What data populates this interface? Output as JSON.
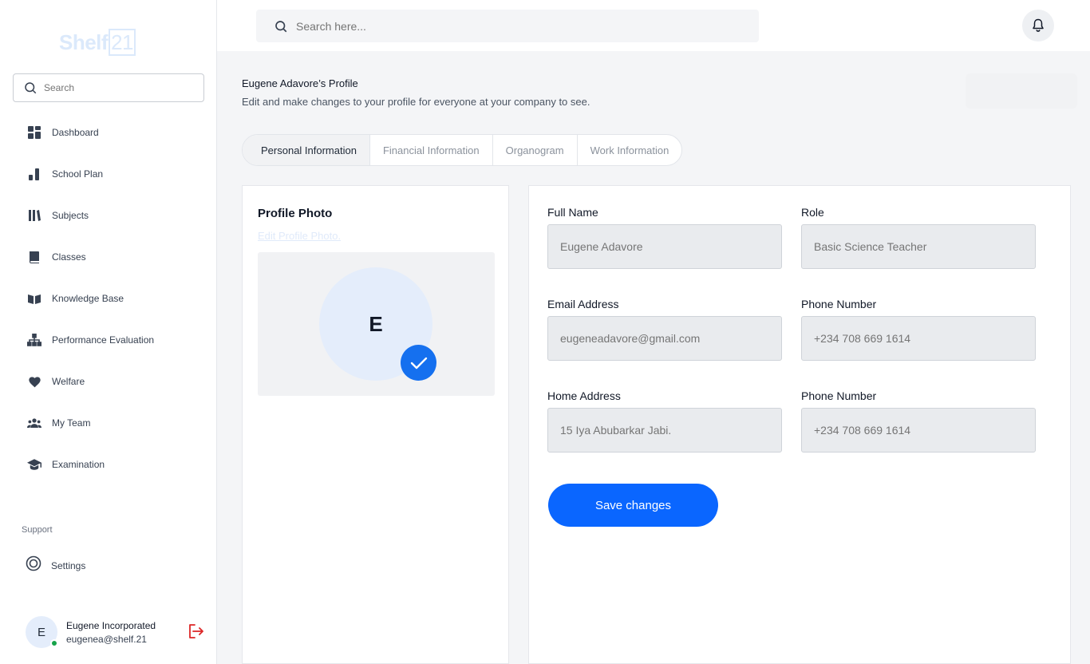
{
  "brand": {
    "logo_text": "Shelf",
    "logo_num": "21"
  },
  "sidebar": {
    "search_placeholder": "Search",
    "items": [
      {
        "label": "Dashboard",
        "icon": "dashboard-icon"
      },
      {
        "label": "School Plan",
        "icon": "bar-chart-icon"
      },
      {
        "label": "Subjects",
        "icon": "books-icon"
      },
      {
        "label": "Classes",
        "icon": "book-icon"
      },
      {
        "label": "Knowledge Base",
        "icon": "open-book-icon"
      },
      {
        "label": "Performance Evaluation",
        "icon": "hierarchy-icon"
      },
      {
        "label": "Welfare",
        "icon": "heart-icon"
      },
      {
        "label": "My Team",
        "icon": "team-icon"
      },
      {
        "label": "Examination",
        "icon": "graduation-cap-icon"
      }
    ],
    "support_label": "Support",
    "settings_label": "Settings"
  },
  "user": {
    "initial": "E",
    "name": "Eugene Incorporated",
    "email": "eugenea@shelf.21",
    "status_color": "#16a34a"
  },
  "topbar": {
    "search_placeholder": "Search here..."
  },
  "page": {
    "title": "Eugene Adavore’s Profile",
    "subtitle": "Edit and make changes to your profile for everyone at your company to see."
  },
  "tabs": [
    {
      "label": "Personal Information",
      "active": true
    },
    {
      "label": "Financial Information",
      "active": false
    },
    {
      "label": "Organogram",
      "active": false
    },
    {
      "label": "Work Information",
      "active": false
    }
  ],
  "photo": {
    "heading": "Profile Photo",
    "edit_link": "Edit Profile Photo.",
    "initial": "E"
  },
  "form": {
    "full_name": {
      "label": "Full Name",
      "placeholder": "Eugene Adavore"
    },
    "role": {
      "label": "Role",
      "placeholder": "Basic Science Teacher"
    },
    "email": {
      "label": "Email Address",
      "placeholder": "eugeneadavore@gmail.com"
    },
    "phone1": {
      "label": "Phone Number",
      "placeholder": "+234 708 669 1614"
    },
    "address": {
      "label": "Home Address",
      "placeholder": "15 Iya Abubarkar Jabi."
    },
    "phone2": {
      "label": "Phone Number",
      "placeholder": "+234 708 669 1614"
    },
    "save_label": "Save changes"
  },
  "colors": {
    "accent": "#0a66ff",
    "check": "#1570ef",
    "logout": "#dc2626"
  }
}
